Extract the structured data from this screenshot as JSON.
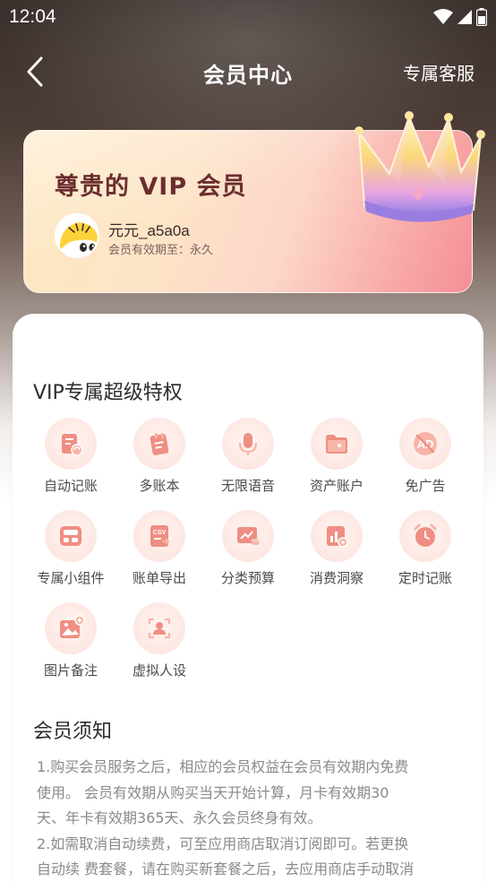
{
  "status_bar": {
    "time": "12:04"
  },
  "nav": {
    "title": "会员中心",
    "right_label": "专属客服"
  },
  "vip_card": {
    "title": "尊贵的 VIP 会员",
    "user_name": "元元_a5a0a",
    "expiry": "会员有效期至：永久"
  },
  "privileges": {
    "title": "VIP专属超级特权",
    "items": [
      {
        "label": "自动记账",
        "icon": "auto-bookkeeping-icon"
      },
      {
        "label": "多账本",
        "icon": "multi-ledger-icon"
      },
      {
        "label": "无限语音",
        "icon": "microphone-icon"
      },
      {
        "label": "资产账户",
        "icon": "asset-folder-icon"
      },
      {
        "label": "免广告",
        "icon": "no-ads-icon"
      },
      {
        "label": "专属小组件",
        "icon": "widget-icon"
      },
      {
        "label": "账单导出",
        "icon": "csv-export-icon"
      },
      {
        "label": "分类预算",
        "icon": "budget-chart-icon"
      },
      {
        "label": "消费洞察",
        "icon": "insight-chart-icon"
      },
      {
        "label": "定时记账",
        "icon": "alarm-clock-icon"
      },
      {
        "label": "图片备注",
        "icon": "image-note-icon"
      },
      {
        "label": "虚拟人设",
        "icon": "virtual-persona-icon"
      }
    ]
  },
  "notice": {
    "title": "会员须知",
    "lines": [
      "1.购买会员服务之后，相应的会员权益在会员有效期内免费",
      "使用。 会员有效期从购买当天开始计算，月卡有效期30",
      "天、年卡有效期365天、永久会员终身有效。",
      "2.如需取消自动续费，可至应用商店取消订阅即可。若更换",
      "自动续 费套餐，请在购买新套餐之后，去应用商店手动取消"
    ]
  },
  "colors": {
    "accent": "#e8837a",
    "vip_title": "#6b2e2e",
    "icon_bg": "#fde7e2"
  }
}
